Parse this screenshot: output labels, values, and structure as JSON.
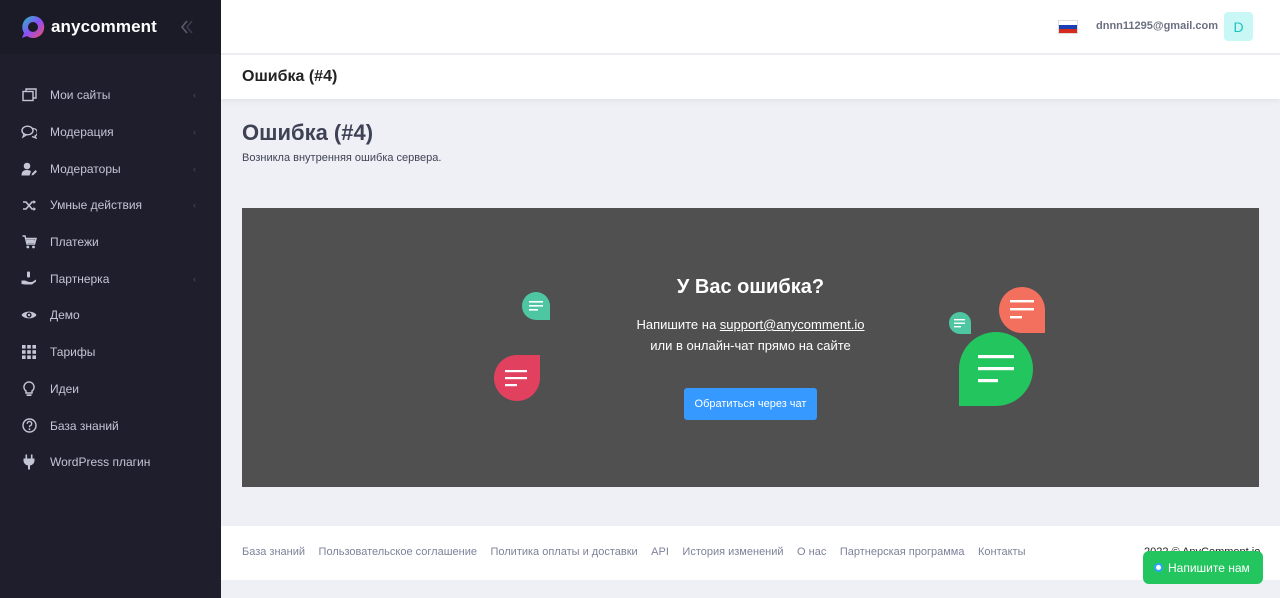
{
  "brand": {
    "name": "anycomment"
  },
  "sidebar": {
    "items": [
      {
        "label": "Мои сайты",
        "icon": "sites-icon",
        "arrow": true
      },
      {
        "label": "Модерация",
        "icon": "comments-icon",
        "arrow": true
      },
      {
        "label": "Модераторы",
        "icon": "user-edit-icon",
        "arrow": true
      },
      {
        "label": "Умные действия",
        "icon": "shuffle-icon",
        "arrow": true
      },
      {
        "label": "Платежи",
        "icon": "cart-icon",
        "arrow": false
      },
      {
        "label": "Партнерка",
        "icon": "hand-coin-icon",
        "arrow": true
      },
      {
        "label": "Демо",
        "icon": "eye-icon",
        "arrow": false
      },
      {
        "label": "Тарифы",
        "icon": "grid-icon",
        "arrow": false
      },
      {
        "label": "Идеи",
        "icon": "lightbulb-icon",
        "arrow": false
      },
      {
        "label": "База знаний",
        "icon": "question-circle-icon",
        "arrow": false
      },
      {
        "label": "WordPress плагин",
        "icon": "plug-icon",
        "arrow": false
      }
    ],
    "arrow_glyph": "‹"
  },
  "topbar": {
    "user_email": "dnnn11295@gmail.com",
    "avatar_letter": "D",
    "flag_colors": [
      "#ffffff",
      "#1c3fb5",
      "#d52b1e"
    ]
  },
  "subheader": {
    "title": "Ошибка (#4)"
  },
  "main": {
    "title": "Ошибка (#4)",
    "description": "Возникла внутренняя ошибка сервера."
  },
  "error_card": {
    "heading": "У Вас ошибка?",
    "line1_prefix": "Напишите на ",
    "email": "support@anycomment.io",
    "line2": "или в онлайн-чат прямо на сайте",
    "button_label": "Обратиться через чат"
  },
  "footer": {
    "links": [
      "База знаний",
      "Пользовательское соглашение",
      "Политика оплаты и доставки",
      "API",
      "История изменений",
      "О нас",
      "Партнерская программа",
      "Контакты"
    ],
    "copyright": "2022 © AnyComment.io"
  },
  "widget": {
    "label": "Напишите нам"
  },
  "colors": {
    "sidebar_bg": "#1e1e2d",
    "accent_blue": "#3699ff",
    "bubble_green": "#23c55e",
    "bubble_teal": "#4fc6a2",
    "bubble_red": "#e2405f",
    "bubble_salmon": "#f2705d"
  }
}
